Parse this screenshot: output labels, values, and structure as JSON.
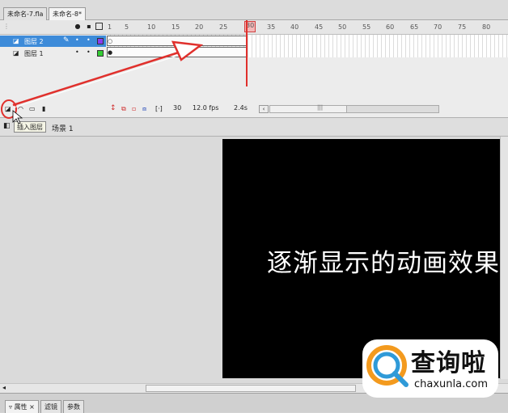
{
  "document_tabs": [
    {
      "label": "未命名-7.fla",
      "active": false
    },
    {
      "label": "未命名-8*",
      "active": true
    }
  ],
  "timeline": {
    "column_icons": [
      "eye-icon",
      "lock-icon",
      "outline-icon"
    ],
    "frame_numbers": [
      "1",
      "5",
      "10",
      "15",
      "20",
      "25",
      "30",
      "35",
      "40",
      "45",
      "50",
      "55",
      "60",
      "65",
      "70",
      "75",
      "80"
    ],
    "playhead_frame": 30,
    "layers": [
      {
        "name": "图层 2",
        "selected": true,
        "outline_color": "#8a3cf0"
      },
      {
        "name": "图层 1",
        "selected": false,
        "outline_color": "#33cc33"
      }
    ],
    "status": {
      "current_frame": "30",
      "frame_rate": "12.0 fps",
      "elapsed_time": "2.4s"
    },
    "insert_layer_tooltip": "插入图层",
    "annotation_color": "#e0302c"
  },
  "scene": {
    "label": "场景 1"
  },
  "stage": {
    "text": "逐渐显示的动画效果",
    "background": "#000000"
  },
  "bottom_tabs": [
    {
      "label": "属性",
      "active": true
    },
    {
      "label": "滤镜",
      "active": false
    },
    {
      "label": "参数",
      "active": false
    }
  ],
  "watermark": {
    "name": "查询啦",
    "url": "chaxunla.com"
  }
}
